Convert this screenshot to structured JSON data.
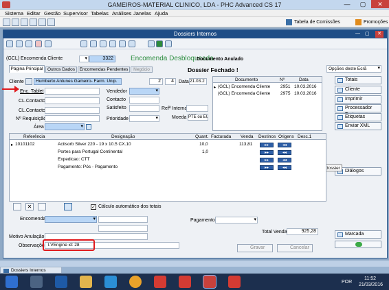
{
  "app": {
    "title": "GAMEIROS-MATERIAL CLINICO, LDA - PHC Advanced CS 17",
    "menu": [
      "Sistema",
      "Editar",
      "Gestão",
      "Supervisor",
      "Tabelas",
      "Análises",
      "Janelas",
      "Ajuda"
    ],
    "right_links": [
      "Tabela de Comissões",
      "Promoções"
    ]
  },
  "window": {
    "title": "Dossiers Internos",
    "doc_type": "(GCL) Encomenda Cliente",
    "doc_number": "3322",
    "heading": "Encomenda Desbloqueada",
    "status_annulled": "Documento Anulado",
    "status_closed": "Dossier Fechado !",
    "tabs": [
      "Página Principal",
      "Outros Dados",
      "Encomendas Pendentes",
      "Negócio"
    ],
    "right_options_label": "Opções deste Ecrã"
  },
  "form": {
    "cliente_label": "Cliente",
    "cliente_value": "Humberto Antunes Gameiro- Farm. Unip.",
    "cliente_num": "2",
    "cliente_est": "4",
    "data_label": "Data",
    "data_value": "21.03.2",
    "enc_tablet_label": "Enc. Tablet",
    "vendedor_label": "Vendedor",
    "cl_contacto_label_1": "CL.Contacto",
    "contacto_label": "Contacto",
    "cl_contacto_label_2": "CL.Contacto",
    "satisfeito_label": "Satisfeito",
    "ref_interna_label": "Refª Interna",
    "requisicao_label": "Nº Requisição",
    "prioridade_label": "Prioridade",
    "moeda_label": "Moeda",
    "moeda_value": "PTE ou EURO",
    "area_label": "Área"
  },
  "related_docs": {
    "headers": [
      "Documento",
      "Nº",
      "Data"
    ],
    "rows": [
      {
        "documento": "(GCL) Encomenda Cliente",
        "numero": "2951",
        "data": "10.03.2016"
      },
      {
        "documento": "(GCL) Encomenda Cliente",
        "numero": "2975",
        "data": "10.03.2016"
      }
    ]
  },
  "side_buttons": [
    "Totais",
    "Cliente",
    "Imprimir",
    "Processador Texto",
    "Etiquetas",
    "Enviar XML",
    "Diálogos",
    "Marcada"
  ],
  "tooltip": "Linhas do dossier",
  "lines": {
    "headers": [
      "Referência",
      "Designação",
      "Quant.",
      "Facturada",
      "Venda",
      "Destinos",
      "Origens",
      "Desc.1"
    ],
    "rows": [
      {
        "ref": "10101102",
        "designacao": "Actisorb Silver 220 - 19 x 10.5 CX.10",
        "quant": "10,0",
        "facturada": "",
        "venda": "113,81"
      },
      {
        "ref": "",
        "designacao": "Portes para Portugal Continental",
        "quant": "1,0",
        "facturada": "",
        "venda": ""
      },
      {
        "ref": "",
        "designacao": "Expedicao: CTT",
        "quant": "",
        "facturada": "",
        "venda": ""
      },
      {
        "ref": "",
        "designacao": "Pagamento: Pós - Pagamento",
        "quant": "",
        "facturada": "",
        "venda": ""
      }
    ]
  },
  "footer": {
    "calc_auto_label": "Cálculo automático dos totais",
    "encomenda_label": "Encomenda",
    "pagamento_label": "Pagamento",
    "total_venda_label": "Total Venda",
    "total_venda_value": "925,28",
    "motivo_label": "Motivo Anulação",
    "observacoes_label": "Observações",
    "observacoes_value": "l.VEngine id: 28",
    "gravar_label": "Gravar",
    "cancelar_label": "Cancelar"
  },
  "taskbar": {
    "doc_tab": "Dossiers Internos",
    "lang": "POR",
    "time": "11:52",
    "date": "21/03/2016"
  },
  "colors": {
    "accent": "#1e4d86",
    "heading_green": "#2b8c3e",
    "annotation_red": "#e0191c"
  }
}
